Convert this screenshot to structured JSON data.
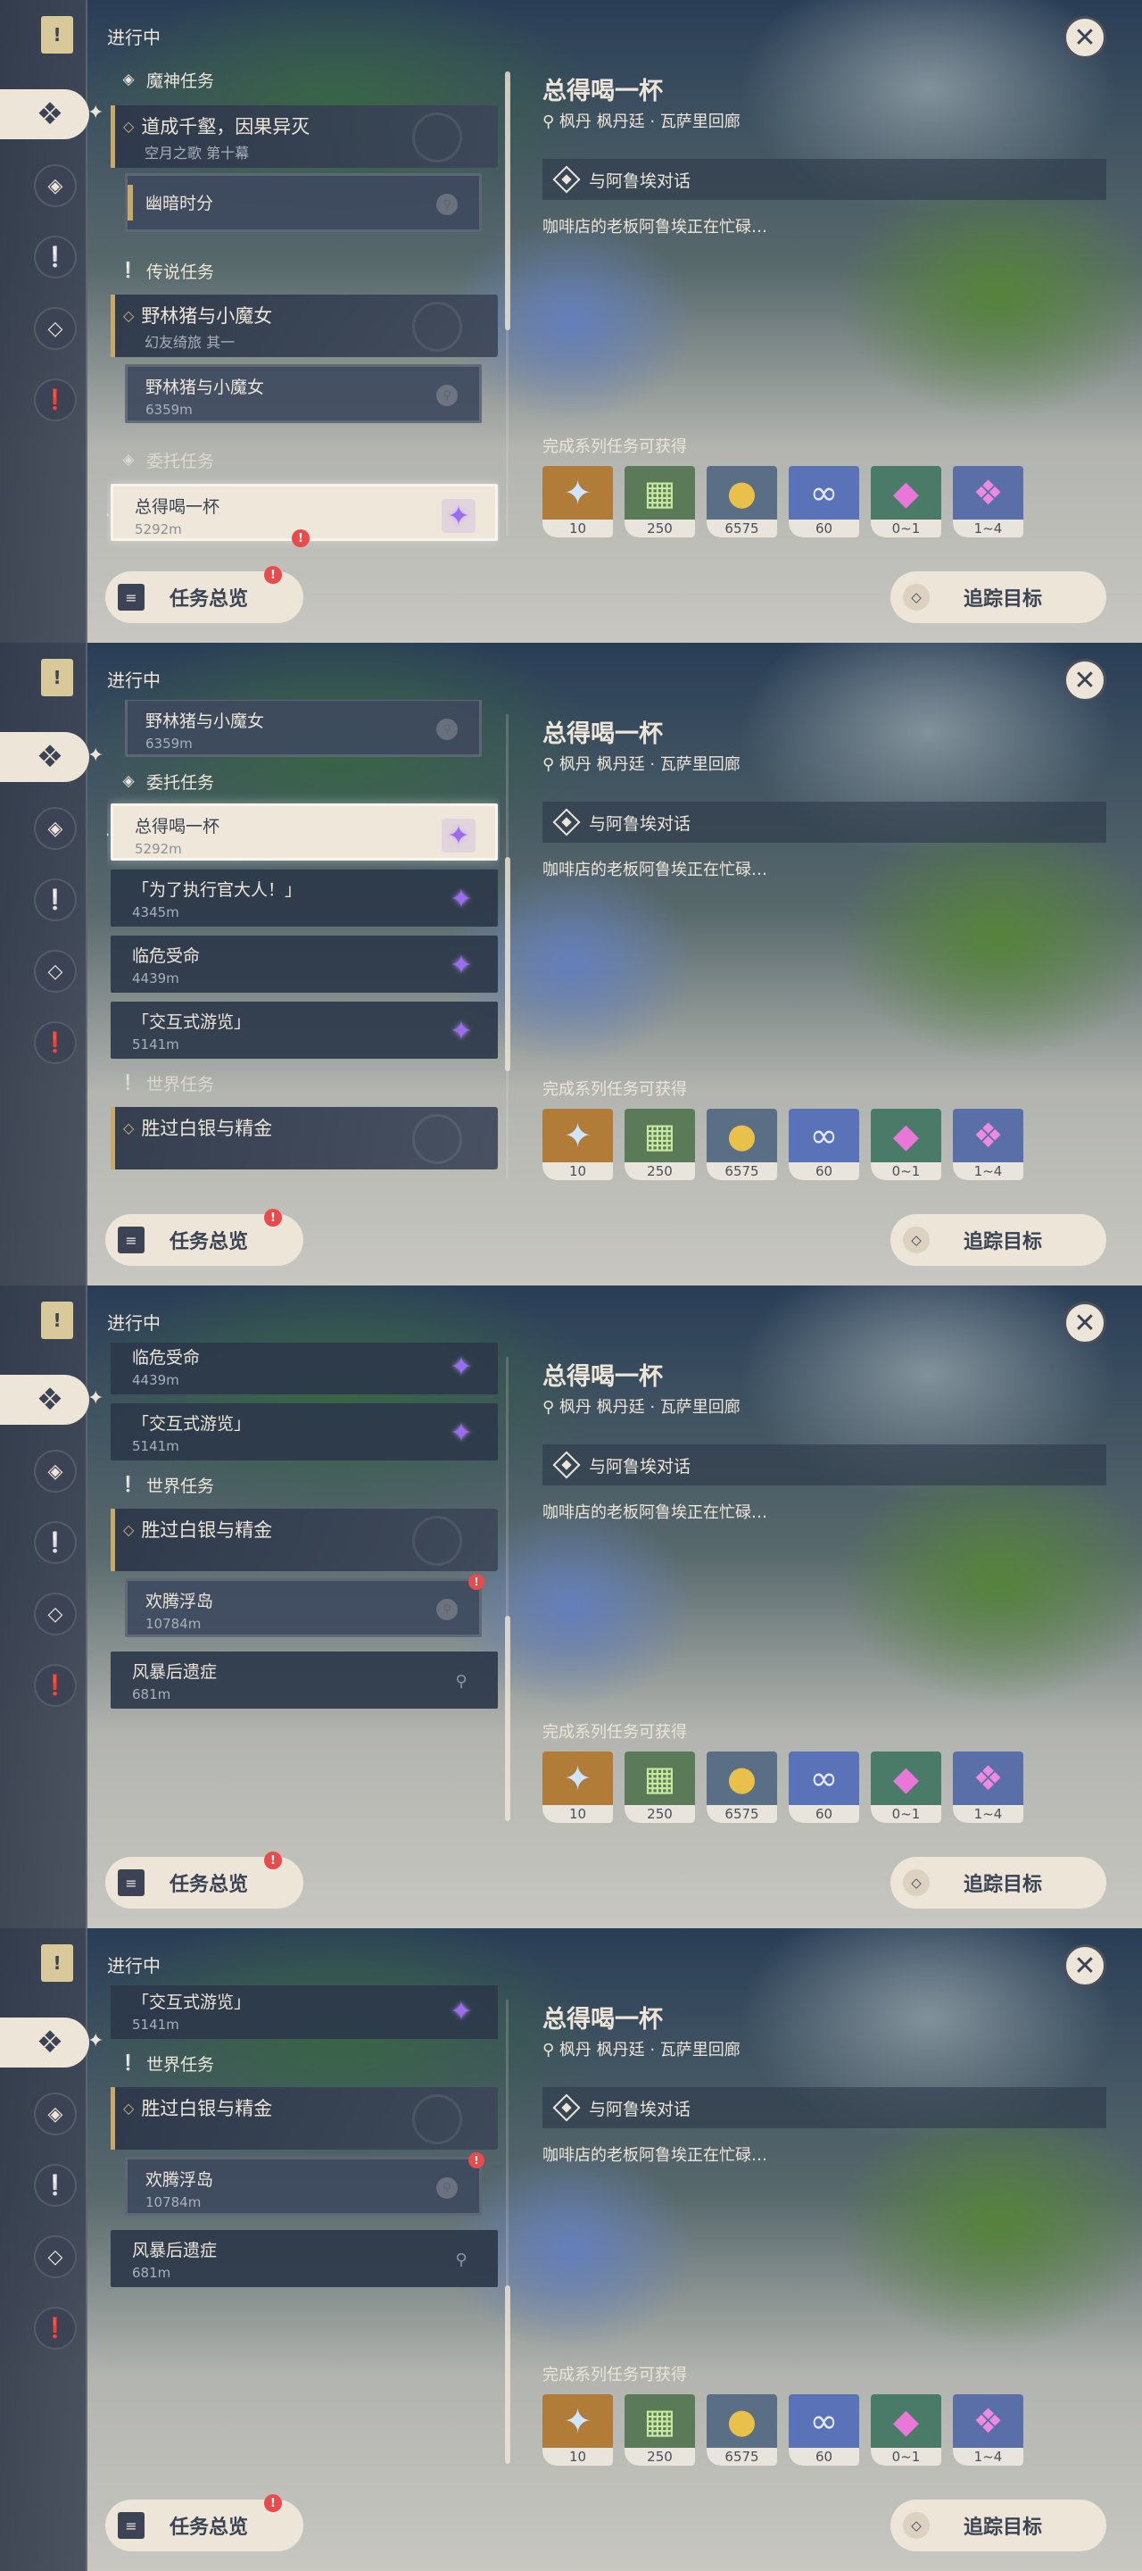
{
  "app": {
    "in_progress": "进行中",
    "bookmark_icon": "bookmark-icon",
    "close_icon": "close-icon"
  },
  "nav": {
    "items": [
      "all-quests-icon",
      "archon-quest-icon",
      "story-quest-icon",
      "world-quest-icon",
      "commission-icon"
    ]
  },
  "categories": {
    "archon": "魔神任务",
    "legend": "传说任务",
    "commission": "委托任务",
    "world": "世界任务"
  },
  "quests": {
    "archon_main": {
      "title": "道成千壑，因果异灭",
      "sub": "空月之歌 第十幕"
    },
    "archon_step": {
      "title": "幽暗时分"
    },
    "legend_main": {
      "title": "野林猪与小魔女",
      "sub": "幻友绮旅 其一"
    },
    "legend_step": {
      "title": "野林猪与小魔女",
      "dist": "6359m"
    },
    "c1": {
      "title": "总得喝一杯",
      "dist": "5292m"
    },
    "c2": {
      "title": "「为了执行官大人！」",
      "dist": "4345m"
    },
    "c3": {
      "title": "临危受命",
      "dist": "4439m"
    },
    "c4": {
      "title": "「交互式游览」",
      "dist": "5141m"
    },
    "world_main": {
      "title": "胜过白银与精金"
    },
    "world_step": {
      "title": "欢腾浮岛",
      "dist": "10784m"
    },
    "world_other": {
      "title": "风暴后遗症",
      "dist": "681m"
    }
  },
  "detail": {
    "title": "总得喝一杯",
    "location": "枫丹 枫丹廷 · 瓦萨里回廊",
    "step": "与阿鲁埃对话",
    "desc": "咖啡店的老板阿鲁埃正在忙碌…",
    "reward_label": "完成系列任务可获得",
    "rewards": [
      {
        "icon": "primogem-icon",
        "count": "10",
        "bg": "#b07c38"
      },
      {
        "icon": "adventure-exp-icon",
        "count": "250",
        "bg": "#5a7a58"
      },
      {
        "icon": "mora-icon",
        "count": "6575",
        "bg": "#5a6f86"
      },
      {
        "icon": "companionship-exp-icon",
        "count": "60",
        "bg": "#5a72b8"
      },
      {
        "icon": "crystal-fragment-icon",
        "count": "0~1",
        "bg": "#4a7a68"
      },
      {
        "icon": "crystal-chunk-icon",
        "count": "1~4",
        "bg": "#5a6fa8"
      }
    ]
  },
  "buttons": {
    "overview": "任务总览",
    "track": "追踪目标"
  },
  "colors": {
    "accent": "#ece5d8",
    "gold": "#c9a96a",
    "alert": "#e74b4b",
    "commission_gem": "#9b6cf0"
  }
}
